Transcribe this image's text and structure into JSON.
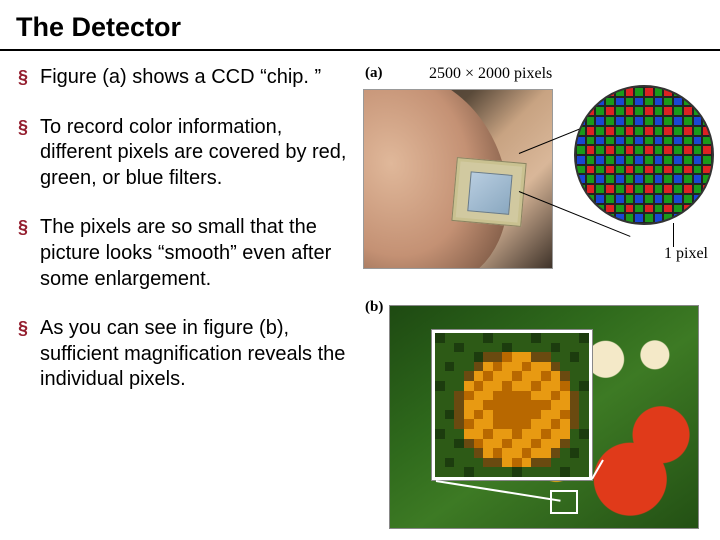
{
  "title": "The Detector",
  "bullets": [
    "Figure (a) shows a CCD “chip. ”",
    "To record color information, different pixels are covered by red, green, or blue filters.",
    "The pixels are so small that the picture looks “smooth” even after some enlargement.",
    "As you can see in figure (b), sufficient magnification reveals the individual pixels."
  ],
  "figure_a": {
    "label": "(a)",
    "dimensions": "2500 × 2000 pixels",
    "pixel_label": "1 pixel"
  },
  "figure_b": {
    "label": "(b)"
  }
}
